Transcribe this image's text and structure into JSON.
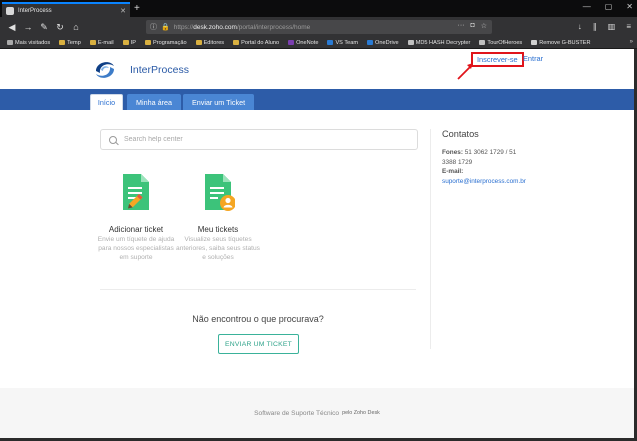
{
  "browser": {
    "tab_title": "InterProcess",
    "url_prefix": "https://",
    "url_domain": "desk.zoho.com",
    "url_path": "/portal/interprocess/home",
    "bookmarks": [
      {
        "label": "Mais visitados",
        "color": "#aaaaaa"
      },
      {
        "label": "Temp",
        "color": "#d9b040"
      },
      {
        "label": "E-mail",
        "color": "#d9b040"
      },
      {
        "label": "IP",
        "color": "#d9b040"
      },
      {
        "label": "Programação",
        "color": "#d9b040"
      },
      {
        "label": "Editores",
        "color": "#d9b040"
      },
      {
        "label": "Portal do Aluno",
        "color": "#d9b040"
      },
      {
        "label": "OneNote",
        "color": "#7b3fb0"
      },
      {
        "label": "VS Team",
        "color": "#2a7bd4"
      },
      {
        "label": "OneDrive",
        "color": "#2a7bd4"
      },
      {
        "label": "MD5 HASH Decrypter",
        "color": "#c0c0c0"
      },
      {
        "label": "TourOfHeroes",
        "color": "#c0c0c0"
      },
      {
        "label": "Remove G-BUSTER",
        "color": "#d0d0d0"
      }
    ]
  },
  "header": {
    "brand": "InterProcess",
    "signup": "Inscrever-se",
    "login": "Entrar"
  },
  "tabs": [
    "Início",
    "Minha área",
    "Enviar um Ticket"
  ],
  "search": {
    "placeholder": "Search help center"
  },
  "cards": [
    {
      "title": "Adicionar ticket",
      "desc": "Envie um tíquete de ajuda para nossos especialistas em suporte"
    },
    {
      "title": "Meu tickets",
      "desc": "Visualize seus tíquetes anteriores, saiba seus status e soluções"
    }
  ],
  "notfound": "Não encontrou o que procurava?",
  "ticket_button": "ENVIAR UM TICKET",
  "contacts": {
    "title": "Contatos",
    "phones_label": "Fones:",
    "phones_1": "51 3062 1729 / 51",
    "phones_2": "3388 1729",
    "email_label": "E-mail:",
    "email": "suporte@interprocess.com.br"
  },
  "footer": {
    "main": "Software de Suporte Técnico",
    "sub": "pelo Zoho Desk"
  },
  "colors": {
    "accent_blue": "#2d5ca8",
    "highlight_red": "#e0141b",
    "ticket_green": "#2fa38a"
  }
}
